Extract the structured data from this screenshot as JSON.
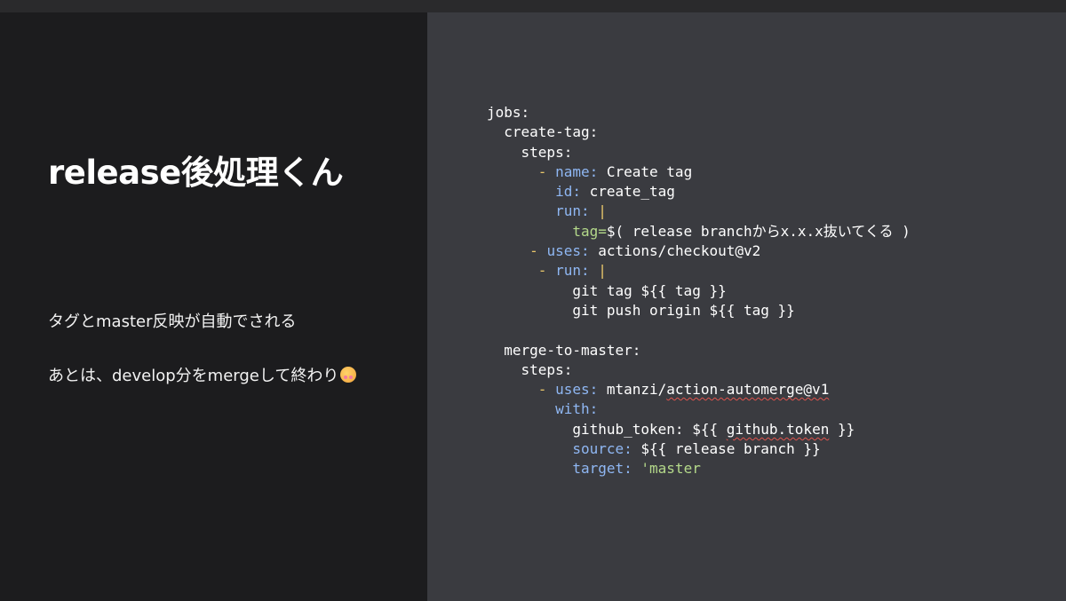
{
  "slide": {
    "title": "release後処理くん",
    "bullets": [
      "タグとmaster反映が自動でされる",
      "あとは、develop分をmergeして終わり"
    ],
    "emoji_icon": "smiling-face-with-hearts-icon"
  },
  "code": {
    "language": "yaml",
    "lines": [
      {
        "indent": "",
        "parts": [
          {
            "t": "jobs:",
            "c": "k"
          }
        ]
      },
      {
        "indent": "  ",
        "parts": [
          {
            "t": "create-tag:",
            "c": "k"
          }
        ]
      },
      {
        "indent": "    ",
        "parts": [
          {
            "t": "steps:",
            "c": "k"
          }
        ]
      },
      {
        "indent": "      ",
        "parts": [
          {
            "t": "- ",
            "c": "d"
          },
          {
            "t": "name:",
            "c": "b"
          },
          {
            "t": " Create tag",
            "c": "w"
          }
        ]
      },
      {
        "indent": "        ",
        "parts": [
          {
            "t": "id:",
            "c": "b"
          },
          {
            "t": " create_tag",
            "c": "w"
          }
        ]
      },
      {
        "indent": "        ",
        "parts": [
          {
            "t": "run:",
            "c": "b"
          },
          {
            "t": " |",
            "c": "d"
          }
        ]
      },
      {
        "indent": "          ",
        "parts": [
          {
            "t": "tag=",
            "c": "g"
          },
          {
            "t": "$( release branchからx.x.x抜いてくる )",
            "c": "w"
          }
        ]
      },
      {
        "indent": "     ",
        "parts": [
          {
            "t": "- ",
            "c": "d"
          },
          {
            "t": "uses:",
            "c": "b"
          },
          {
            "t": " actions/checkout@v2",
            "c": "w"
          }
        ]
      },
      {
        "indent": "      ",
        "parts": [
          {
            "t": "- ",
            "c": "d"
          },
          {
            "t": "run:",
            "c": "b"
          },
          {
            "t": " |",
            "c": "d"
          }
        ]
      },
      {
        "indent": "          ",
        "parts": [
          {
            "t": "git tag ${{ tag }}",
            "c": "w"
          }
        ]
      },
      {
        "indent": "          ",
        "parts": [
          {
            "t": "git push origin ${{ tag }}",
            "c": "w"
          }
        ]
      },
      {
        "indent": "",
        "parts": [
          {
            "t": "",
            "c": "w"
          }
        ]
      },
      {
        "indent": "  ",
        "parts": [
          {
            "t": "merge-to-master:",
            "c": "k"
          }
        ]
      },
      {
        "indent": "    ",
        "parts": [
          {
            "t": "steps:",
            "c": "k"
          }
        ]
      },
      {
        "indent": "      ",
        "parts": [
          {
            "t": "- ",
            "c": "d"
          },
          {
            "t": "uses:",
            "c": "b"
          },
          {
            "t": " mtanzi/",
            "c": "w"
          },
          {
            "t": "action-automerge@v1",
            "c": "w",
            "squig": true
          }
        ]
      },
      {
        "indent": "        ",
        "parts": [
          {
            "t": "with:",
            "c": "b"
          }
        ]
      },
      {
        "indent": "          ",
        "parts": [
          {
            "t": "github_token:",
            "c": "w"
          },
          {
            "t": " ${{ ",
            "c": "w"
          },
          {
            "t": "github.token",
            "c": "w",
            "squig": true
          },
          {
            "t": " }}",
            "c": "w"
          }
        ]
      },
      {
        "indent": "          ",
        "parts": [
          {
            "t": "source:",
            "c": "b"
          },
          {
            "t": " ${{ release branch }}",
            "c": "w"
          }
        ]
      },
      {
        "indent": "          ",
        "parts": [
          {
            "t": "target:",
            "c": "b"
          },
          {
            "t": " 'master",
            "c": "g"
          }
        ]
      }
    ]
  }
}
